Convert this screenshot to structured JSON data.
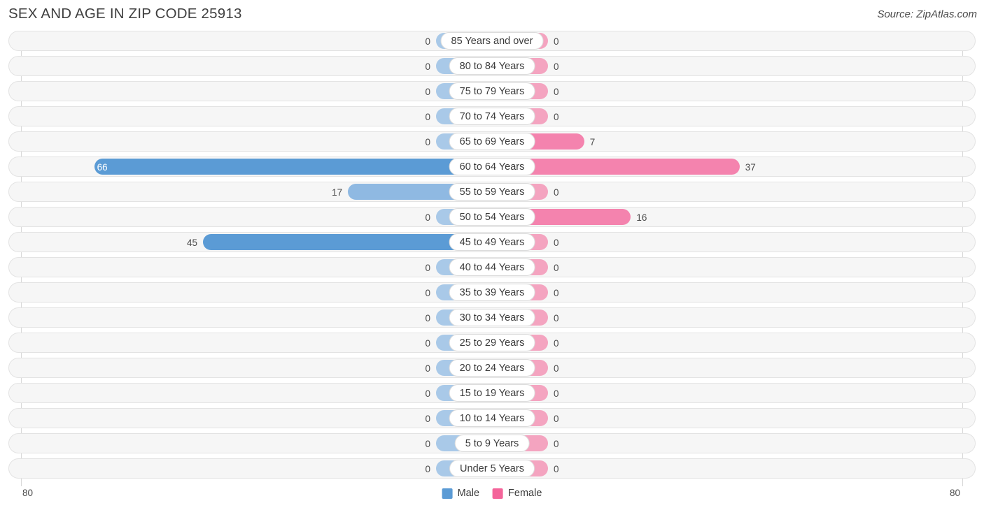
{
  "header": {
    "title": "SEX AND AGE IN ZIP CODE 25913",
    "source": "Source: ZipAtlas.com"
  },
  "axis": {
    "left_tick": "80",
    "right_tick": "80",
    "max": 80
  },
  "legend": {
    "male_label": "Male",
    "female_label": "Female",
    "male_color": "#5b9bd5",
    "female_color": "#f4649a"
  },
  "colors": {
    "male_strong": "#5b9bd5",
    "male_mid": "#8fb9e2",
    "male_light": "#a9c9e8",
    "female_strong": "#f4649a",
    "female_mid": "#f483ae",
    "female_light": "#f4a4c0",
    "track": "#f6f6f6",
    "track_border": "#e3e3e3"
  },
  "chart_data": {
    "type": "bar",
    "subtype": "population-pyramid",
    "title": "SEX AND AGE IN ZIP CODE 25913",
    "xlabel": "",
    "ylabel": "",
    "xlim": [
      -80,
      80
    ],
    "grid": false,
    "legend_position": "bottom-center",
    "categories": [
      "85 Years and over",
      "80 to 84 Years",
      "75 to 79 Years",
      "70 to 74 Years",
      "65 to 69 Years",
      "60 to 64 Years",
      "55 to 59 Years",
      "50 to 54 Years",
      "45 to 49 Years",
      "40 to 44 Years",
      "35 to 39 Years",
      "30 to 34 Years",
      "25 to 29 Years",
      "20 to 24 Years",
      "15 to 19 Years",
      "10 to 14 Years",
      "5 to 9 Years",
      "Under 5 Years"
    ],
    "series": [
      {
        "name": "Male",
        "color": "#5b9bd5",
        "values": [
          0,
          0,
          0,
          0,
          0,
          66,
          17,
          0,
          45,
          0,
          0,
          0,
          0,
          0,
          0,
          0,
          0,
          0
        ]
      },
      {
        "name": "Female",
        "color": "#f4649a",
        "values": [
          0,
          0,
          0,
          0,
          7,
          37,
          0,
          16,
          0,
          0,
          0,
          0,
          0,
          0,
          0,
          0,
          0,
          0
        ]
      }
    ]
  }
}
